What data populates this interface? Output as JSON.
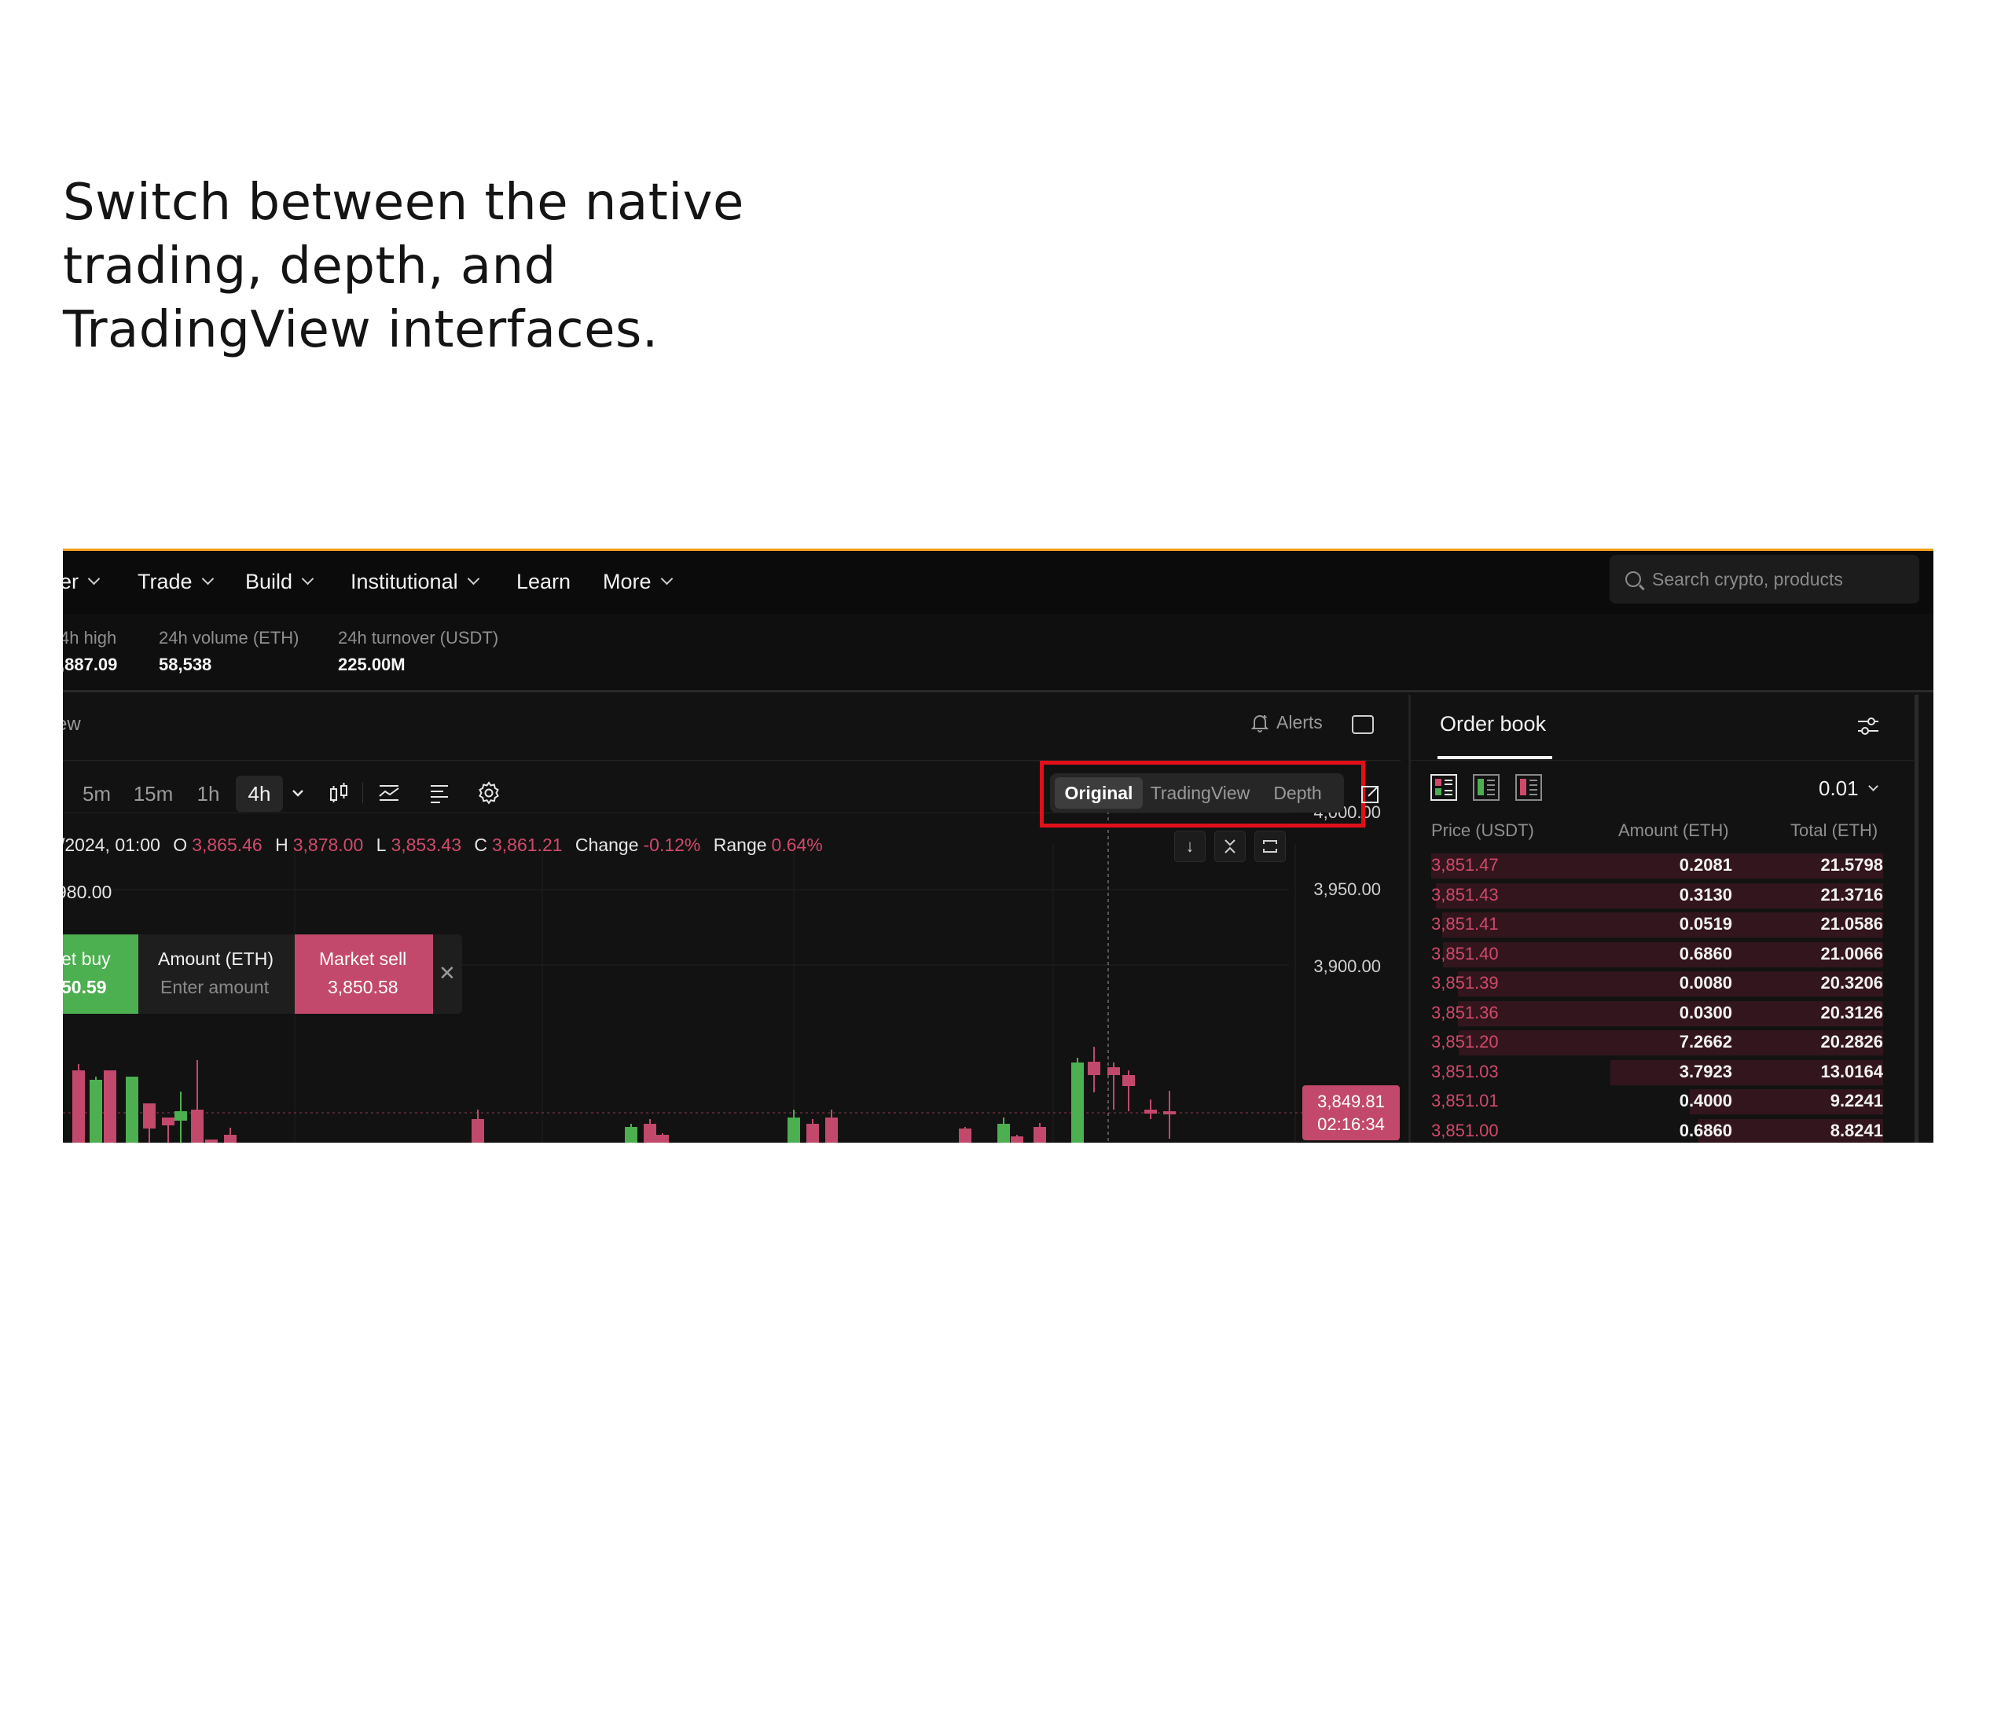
{
  "headline": {
    "line1": "Switch between the native",
    "line2": "trading, depth, and",
    "line3": "TradingView interfaces."
  },
  "nav": {
    "items": [
      {
        "label": "er",
        "has_dropdown": true
      },
      {
        "label": "Trade",
        "has_dropdown": true
      },
      {
        "label": "Build",
        "has_dropdown": true
      },
      {
        "label": "Institutional",
        "has_dropdown": true
      },
      {
        "label": "Learn",
        "has_dropdown": false
      },
      {
        "label": "More",
        "has_dropdown": true
      }
    ],
    "search_placeholder": "Search crypto, products"
  },
  "stats": [
    {
      "label": "4h high",
      "value": ",887.09"
    },
    {
      "label": "24h volume (ETH)",
      "value": "58,538"
    },
    {
      "label": "24h turnover (USDT)",
      "value": "225.00M"
    }
  ],
  "chart": {
    "panel_title": "ew",
    "alerts_label": "Alerts",
    "timeframes": [
      "5m",
      "15m",
      "1h",
      "4h"
    ],
    "active_timeframe": "4h",
    "view_options": [
      "Original",
      "TradingView",
      "Depth"
    ],
    "active_view": "Original",
    "ohlc": {
      "date": "/2024, 01:00",
      "o_label": "O",
      "o": "3,865.46",
      "h_label": "H",
      "h": "3,878.00",
      "l_label": "L",
      "l": "3,853.43",
      "c_label": "C",
      "c": "3,861.21",
      "change_label": "Change",
      "change": "-0.12%",
      "range_label": "Range",
      "range": "0.64%"
    },
    "ma_value": "980.00",
    "y_ticks": [
      "4,000.00",
      "3,950.00",
      "3,900.00"
    ],
    "current_price": "3,849.81",
    "countdown": "02:16:34",
    "quick_trade": {
      "buy_label": "et buy",
      "buy_price": "50.59",
      "amount_label": "Amount (ETH)",
      "amount_placeholder": "Enter amount",
      "sell_label": "Market sell",
      "sell_price": "3,850.58",
      "close_glyph": "✕"
    },
    "colors": {
      "up": "#4caf50",
      "down": "#c2496b",
      "highlight": "#e0101a"
    }
  },
  "orderbook": {
    "title": "Order book",
    "step": "0.01",
    "headers": {
      "price": "Price (USDT)",
      "amount": "Amount (ETH)",
      "total": "Total (ETH)"
    },
    "asks": [
      {
        "price": "3,851.47",
        "amount": "0.2081",
        "total": "21.5798"
      },
      {
        "price": "3,851.43",
        "amount": "0.3130",
        "total": "21.3716"
      },
      {
        "price": "3,851.41",
        "amount": "0.0519",
        "total": "21.0586"
      },
      {
        "price": "3,851.40",
        "amount": "0.6860",
        "total": "21.0066"
      },
      {
        "price": "3,851.39",
        "amount": "0.0080",
        "total": "20.3206"
      },
      {
        "price": "3,851.36",
        "amount": "0.0300",
        "total": "20.3126"
      },
      {
        "price": "3,851.20",
        "amount": "7.2662",
        "total": "20.2826"
      },
      {
        "price": "3,851.03",
        "amount": "3.7923",
        "total": "13.0164"
      },
      {
        "price": "3,851.01",
        "amount": "0.4000",
        "total": "9.2241"
      },
      {
        "price": "3,851.00",
        "amount": "0.6860",
        "total": "8.8241"
      }
    ]
  }
}
